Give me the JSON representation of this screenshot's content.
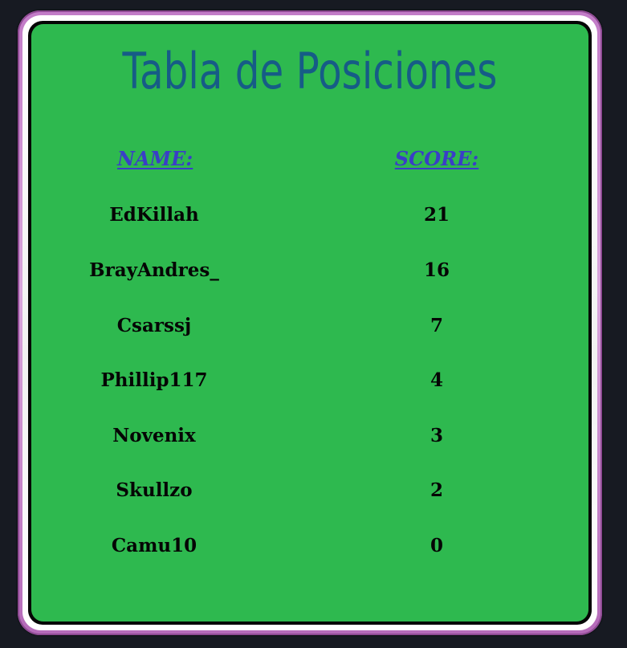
{
  "title": "Tabla de Posiciones",
  "columns": {
    "name": "NAME:",
    "score": "SCORE:"
  },
  "rows": [
    {
      "name": "EdKillah",
      "score": "21"
    },
    {
      "name": "BrayAndres_",
      "score": "16"
    },
    {
      "name": "Csarssj",
      "score": "7"
    },
    {
      "name": "Phillip117",
      "score": "4"
    },
    {
      "name": "Novenix",
      "score": "3"
    },
    {
      "name": "Skullzo",
      "score": "2"
    },
    {
      "name": "Camu10",
      "score": "0"
    }
  ],
  "colors": {
    "background": "#171a22",
    "panel": "#2eb94f",
    "title": "#165c86",
    "header": "#3a3ec7",
    "frame": "#c27bc7",
    "text": "#050505"
  }
}
